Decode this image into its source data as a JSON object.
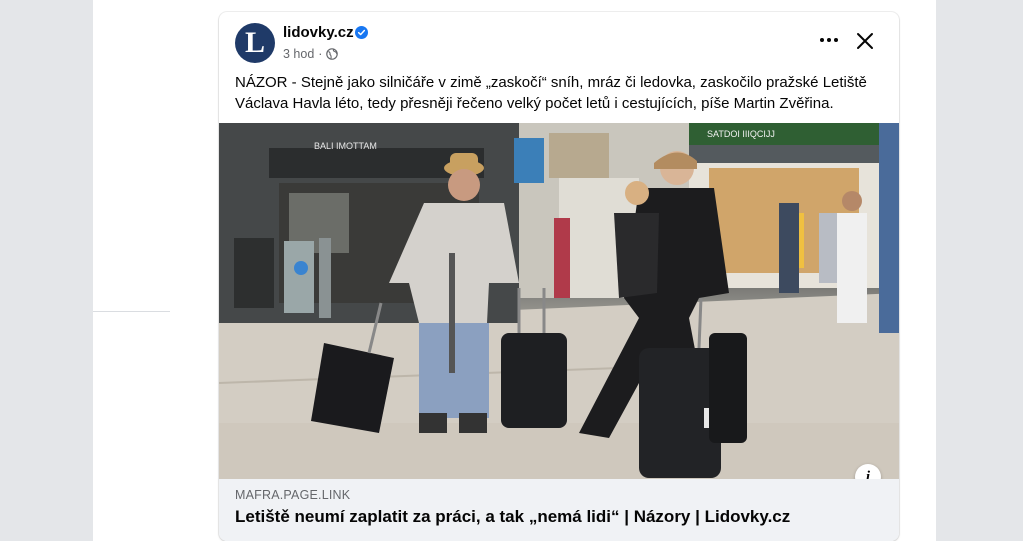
{
  "post": {
    "page_name": "lidovky.cz",
    "avatar_letter": "L",
    "time": "3 hod",
    "separator": "·",
    "text": "NÁZOR - Stejně jako silničáře v zimě „zaskočí“ sníh, mráz či ledovka, zaskočilo pražské Letiště Václava Havla léto, tedy přesněji řečeno velký počet letů i cestujících, píše Martin Zvěřina."
  },
  "link_preview": {
    "domain": "MAFRA.PAGE.LINK",
    "title": "Letiště neumí zaplatit za práci, a tak „nemá lidi“ | Názory | Lidovky.cz",
    "info_glyph": "i"
  },
  "icons": {
    "verified": "verified-badge-icon",
    "audience": "globe-icon",
    "more": "more-options-icon",
    "close": "close-icon",
    "info": "info-icon"
  },
  "colors": {
    "verified": "#1877f2",
    "avatar_bg": "#1f3a68",
    "link_box_bg": "#f0f2f5",
    "meta_text": "#65676b"
  }
}
